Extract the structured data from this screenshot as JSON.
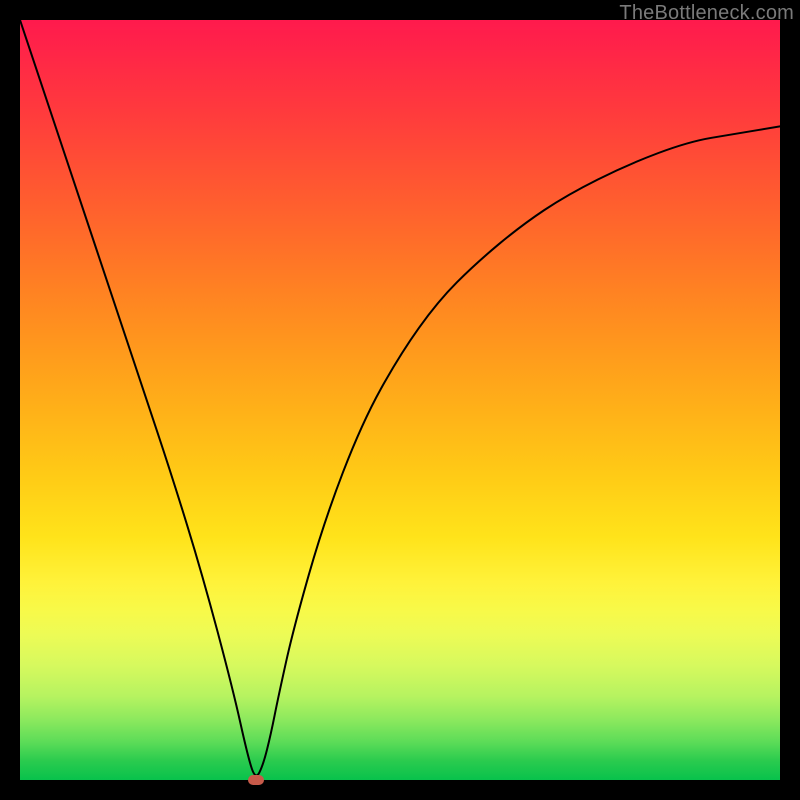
{
  "watermark": "TheBottleneck.com",
  "chart_data": {
    "type": "line",
    "title": "",
    "xlabel": "",
    "ylabel": "",
    "xlim": [
      0,
      100
    ],
    "ylim": [
      0,
      100
    ],
    "grid": false,
    "legend": false,
    "background_gradient": {
      "direction": "vertical",
      "stops": [
        {
          "pos": 0.0,
          "color": "#ff1a4d"
        },
        {
          "pos": 0.2,
          "color": "#ff5233"
        },
        {
          "pos": 0.4,
          "color": "#ff8f20"
        },
        {
          "pos": 0.6,
          "color": "#ffcb16"
        },
        {
          "pos": 0.78,
          "color": "#f7fa4a"
        },
        {
          "pos": 0.9,
          "color": "#8de95e"
        },
        {
          "pos": 1.0,
          "color": "#08c24c"
        }
      ]
    },
    "series": [
      {
        "name": "bottleneck-curve",
        "color": "#000000",
        "width": 2,
        "x": [
          0,
          4,
          8,
          12,
          16,
          20,
          24,
          28,
          30,
          31,
          32,
          33,
          34,
          36,
          40,
          45,
          50,
          55,
          60,
          66,
          72,
          80,
          88,
          94,
          100
        ],
        "y": [
          100,
          88,
          76,
          64,
          52,
          40,
          27,
          12,
          3,
          0,
          2,
          6,
          11,
          20,
          34,
          47,
          56,
          63,
          68,
          73,
          77,
          81,
          84,
          85,
          86
        ]
      }
    ],
    "markers": [
      {
        "name": "optimal-point",
        "x": 31,
        "y": 0,
        "shape": "rounded-rect",
        "color": "#c75a4a"
      }
    ]
  }
}
